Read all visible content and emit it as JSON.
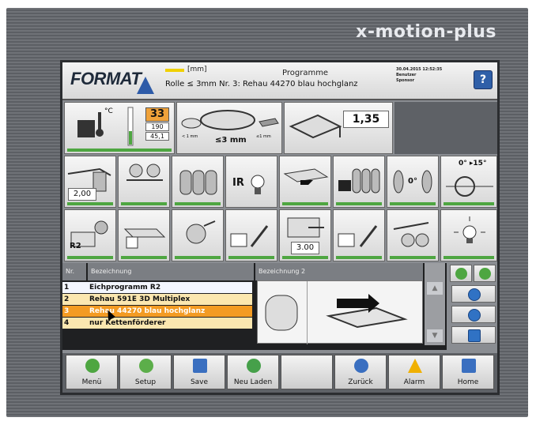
{
  "brand": "x-motion-plus",
  "header": {
    "logo": "FORMAT",
    "unit": "[mm]",
    "title": "Programme",
    "program": "Rolle ≤ 3mm Nr. 3: Rehau 44270 blau hochglanz",
    "datetime": "30.04.2015 12:52:35",
    "user_label": "Benutzer",
    "user_value": "Sponsor",
    "help_icon": "help-icon"
  },
  "row1": {
    "temperature_unit": "°C",
    "temperature": "33",
    "temperature_set": "190",
    "temperature_aux": "45,1",
    "thickness_label": "≤3 mm",
    "thickness_small_left": "< 1 mm",
    "thickness_small_right": "≤1 mm",
    "edge_value": "1,35"
  },
  "row2": {
    "tile1_value": "2,00",
    "ir_label": "IR",
    "angle0": "0°",
    "angle_range": "0° ▸15°"
  },
  "row3": {
    "r2_label": "R2",
    "tile6_value": "3.00"
  },
  "table": {
    "headers": [
      "Nr.",
      "Bezeichnung",
      "Bezeichnung 2"
    ],
    "rows": [
      {
        "nr": "1",
        "name": "Eichprogramm R2"
      },
      {
        "nr": "2",
        "name": "Rehau 591E 3D Multiplex"
      },
      {
        "nr": "3",
        "name": "Rehau 44270 blau hochglanz"
      },
      {
        "nr": "4",
        "name": "nur Kettenförderer"
      }
    ],
    "scroll_up": "▲",
    "scroll_down": "▼"
  },
  "bottom": {
    "buttons": [
      "Menü",
      "Setup",
      "Save",
      "Neu Laden",
      "",
      "Zurück",
      "Alarm",
      "Home"
    ]
  },
  "colors": {
    "accent_green": "#4ea641",
    "highlight_orange": "#f0a23a",
    "blue": "#2f5fa8"
  }
}
